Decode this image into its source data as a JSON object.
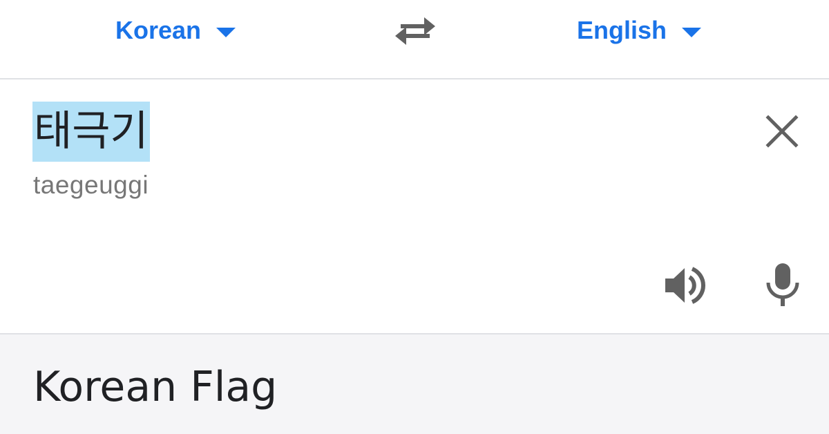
{
  "header": {
    "source_language": "Korean",
    "target_language": "English",
    "swap_icon": "swap-arrows-icon",
    "caret_icon": "caret-down-icon"
  },
  "input": {
    "text": "태극기",
    "romanization": "taegeuggi",
    "clear_icon": "close-icon",
    "speaker_icon": "speaker-icon",
    "mic_icon": "microphone-icon"
  },
  "output": {
    "translation": "Korean Flag"
  },
  "colors": {
    "accent": "#1a73e8",
    "selection_highlight": "#b3e1f7",
    "icon_gray": "#616161",
    "romanization_gray": "#777777",
    "output_background": "#f5f5f7",
    "divider": "#dfe1e5"
  }
}
